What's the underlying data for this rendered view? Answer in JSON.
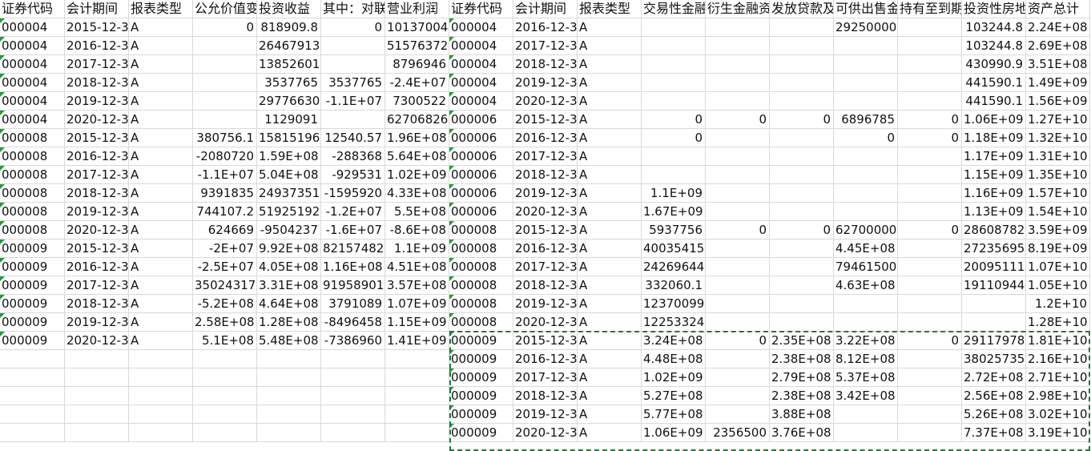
{
  "columns": [
    "证券代码",
    "会计期间",
    "报表类型",
    "公允价值变",
    "投资收益",
    "其中：对联",
    "营业利润",
    "证券代码",
    "会计期间",
    "报表类型",
    "交易性金融",
    "衍生金融资",
    "发放贷款及",
    "可供出售金",
    "持有至到期",
    "投资性房地",
    "资产总计"
  ],
  "rows": [
    [
      "000004",
      "2015-12-31",
      "A",
      "0",
      "818909.8",
      "0",
      "10137004",
      "000004",
      "2016-12-31",
      "A",
      "",
      "",
      "",
      "29250000",
      "",
      "103244.8",
      "2.24E+08"
    ],
    [
      "000004",
      "2016-12-31",
      "A",
      "",
      "26467913",
      "",
      "51576372",
      "000004",
      "2017-12-31",
      "A",
      "",
      "",
      "",
      "",
      "",
      "103244.8",
      "2.69E+08"
    ],
    [
      "000004",
      "2017-12-31",
      "A",
      "",
      "13852601",
      "",
      "8796946",
      "000004",
      "2018-12-31",
      "A",
      "",
      "",
      "",
      "",
      "",
      "430990.9",
      "3.51E+08"
    ],
    [
      "000004",
      "2018-12-31",
      "A",
      "",
      "3537765",
      "3537765",
      "-2.4E+07",
      "000004",
      "2019-12-31",
      "A",
      "",
      "",
      "",
      "",
      "",
      "441590.1",
      "1.49E+09"
    ],
    [
      "000004",
      "2019-12-31",
      "A",
      "",
      "29776630",
      "-1.1E+07",
      "7300522",
      "000004",
      "2020-12-31",
      "A",
      "",
      "",
      "",
      "",
      "",
      "441590.1",
      "1.56E+09"
    ],
    [
      "000004",
      "2020-12-31",
      "A",
      "",
      "1129091",
      "",
      "62706826",
      "000006",
      "2015-12-31",
      "A",
      "0",
      "0",
      "0",
      "6896785",
      "0",
      "1.06E+09",
      "1.27E+10"
    ],
    [
      "000008",
      "2015-12-31",
      "A",
      "380756.1",
      "15815196",
      "12540.57",
      "1.96E+08",
      "000006",
      "2016-12-31",
      "A",
      "0",
      "",
      "",
      "0",
      "0",
      "1.18E+09",
      "1.32E+10"
    ],
    [
      "000008",
      "2016-12-31",
      "A",
      "-2080720",
      "1.59E+08",
      "-288368",
      "5.64E+08",
      "000006",
      "2017-12-31",
      "A",
      "",
      "",
      "",
      "",
      "",
      "1.17E+09",
      "1.31E+10"
    ],
    [
      "000008",
      "2017-12-31",
      "A",
      "-1.1E+07",
      "5.04E+08",
      "-929531",
      "1.02E+09",
      "000006",
      "2018-12-31",
      "A",
      "",
      "",
      "",
      "",
      "",
      "1.15E+09",
      "1.35E+10"
    ],
    [
      "000008",
      "2018-12-31",
      "A",
      "9391835",
      "24937351",
      "-1595920",
      "4.33E+08",
      "000006",
      "2019-12-31",
      "A",
      "1.1E+09",
      "",
      "",
      "",
      "",
      "1.16E+09",
      "1.57E+10"
    ],
    [
      "000008",
      "2019-12-31",
      "A",
      "744107.2",
      "51925192",
      "-1.2E+07",
      "5.5E+08",
      "000006",
      "2020-12-31",
      "A",
      "1.67E+09",
      "",
      "",
      "",
      "",
      "1.13E+09",
      "1.54E+10"
    ],
    [
      "000008",
      "2020-12-31",
      "A",
      "624669",
      "-9504237",
      "-1.6E+07",
      "-8.6E+08",
      "000008",
      "2015-12-31",
      "A",
      "5937756",
      "0",
      "0",
      "62700000",
      "0",
      "28608782",
      "3.59E+09"
    ],
    [
      "000009",
      "2015-12-31",
      "A",
      "-2E+07",
      "9.92E+08",
      "82157482",
      "1.1E+09",
      "000008",
      "2016-12-31",
      "A",
      "40035415",
      "",
      "",
      "4.45E+08",
      "",
      "27235695",
      "8.19E+09"
    ],
    [
      "000009",
      "2016-12-31",
      "A",
      "-2.5E+07",
      "4.05E+08",
      "1.16E+08",
      "4.51E+08",
      "000008",
      "2017-12-31",
      "A",
      "24269644",
      "",
      "",
      "79461500",
      "",
      "20095111",
      "1.07E+10"
    ],
    [
      "000009",
      "2017-12-31",
      "A",
      "35024317",
      "3.31E+08",
      "91958901",
      "3.57E+08",
      "000008",
      "2018-12-31",
      "A",
      "332060.1",
      "",
      "",
      "4.63E+08",
      "",
      "19110944",
      "1.05E+10"
    ],
    [
      "000009",
      "2018-12-31",
      "A",
      "-5.2E+08",
      "4.64E+08",
      "3791089",
      "1.07E+09",
      "000008",
      "2019-12-31",
      "A",
      "12370099",
      "",
      "",
      "",
      "",
      "",
      "1.2E+10"
    ],
    [
      "000009",
      "2019-12-31",
      "A",
      "2.58E+08",
      "1.28E+08",
      "-8496458",
      "1.15E+09",
      "000008",
      "2020-12-31",
      "A",
      "12253324",
      "",
      "",
      "",
      "",
      "",
      "1.28E+10"
    ],
    [
      "000009",
      "2020-12-31",
      "A",
      "5.1E+08",
      "5.48E+08",
      "-7386960",
      "1.41E+09",
      "000009",
      "2015-12-31",
      "A",
      "3.24E+08",
      "0",
      "2.35E+08",
      "3.22E+08",
      "0",
      "29117978",
      "1.81E+10"
    ],
    [
      "",
      "",
      "",
      "",
      "",
      "",
      "",
      "000009",
      "2016-12-31",
      "A",
      "4.48E+08",
      "",
      "2.38E+08",
      "8.12E+08",
      "",
      "38025735",
      "2.16E+10"
    ],
    [
      "",
      "",
      "",
      "",
      "",
      "",
      "",
      "000009",
      "2017-12-31",
      "A",
      "1.02E+09",
      "",
      "2.79E+08",
      "5.37E+08",
      "",
      "2.72E+08",
      "2.71E+10"
    ],
    [
      "",
      "",
      "",
      "",
      "",
      "",
      "",
      "000009",
      "2018-12-31",
      "A",
      "5.27E+08",
      "",
      "2.38E+08",
      "3.42E+08",
      "",
      "2.56E+08",
      "2.98E+10"
    ],
    [
      "",
      "",
      "",
      "",
      "",
      "",
      "",
      "000009",
      "2019-12-31",
      "A",
      "5.77E+08",
      "",
      "3.88E+08",
      "",
      "",
      "5.26E+08",
      "3.02E+10"
    ],
    [
      "",
      "",
      "",
      "",
      "",
      "",
      "",
      "000009",
      "2020-12-31",
      "A",
      "1.06E+09",
      "2356500",
      "3.76E+08",
      "",
      "",
      "7.37E+08",
      "3.19E+10"
    ]
  ],
  "colors": {
    "gridline": "#d9d9d9",
    "error_marker": "#1f9d3a",
    "selection_border": "#1e7b34"
  }
}
